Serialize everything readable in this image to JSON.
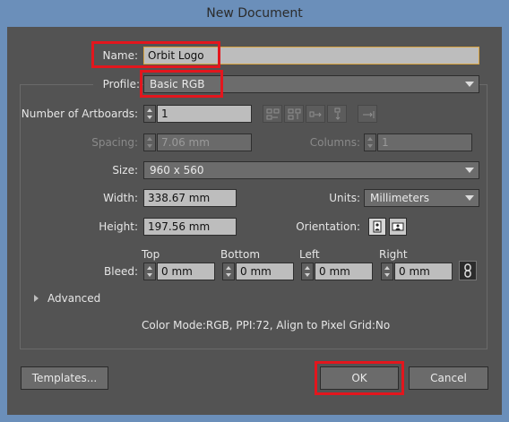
{
  "window": {
    "title": "New Document"
  },
  "name": {
    "label": "Name:",
    "value": "Orbit Logo"
  },
  "profile": {
    "label": "Profile:",
    "value": "Basic RGB"
  },
  "artboards": {
    "label": "Number of Artboards:",
    "value": "1"
  },
  "spacing": {
    "label": "Spacing:",
    "value": "7.06 mm"
  },
  "columns": {
    "label": "Columns:",
    "value": "1"
  },
  "size": {
    "label": "Size:",
    "value": "960 x 560"
  },
  "width": {
    "label": "Width:",
    "value": "338.67 mm"
  },
  "units": {
    "label": "Units:",
    "value": "Millimeters"
  },
  "height": {
    "label": "Height:",
    "value": "197.56 mm"
  },
  "orientation": {
    "label": "Orientation:"
  },
  "bleed": {
    "label": "Bleed:",
    "top": {
      "label": "Top",
      "value": "0 mm"
    },
    "bottom": {
      "label": "Bottom",
      "value": "0 mm"
    },
    "left": {
      "label": "Left",
      "value": "0 mm"
    },
    "right": {
      "label": "Right",
      "value": "0 mm"
    }
  },
  "advanced": {
    "label": "Advanced"
  },
  "summary": "Color Mode:RGB, PPI:72, Align to Pixel Grid:No",
  "buttons": {
    "templates": "Templates...",
    "ok": "OK",
    "cancel": "Cancel"
  },
  "colors": {
    "highlight": "#e3161d",
    "panel": "#535353",
    "frame": "#6b8fba"
  }
}
